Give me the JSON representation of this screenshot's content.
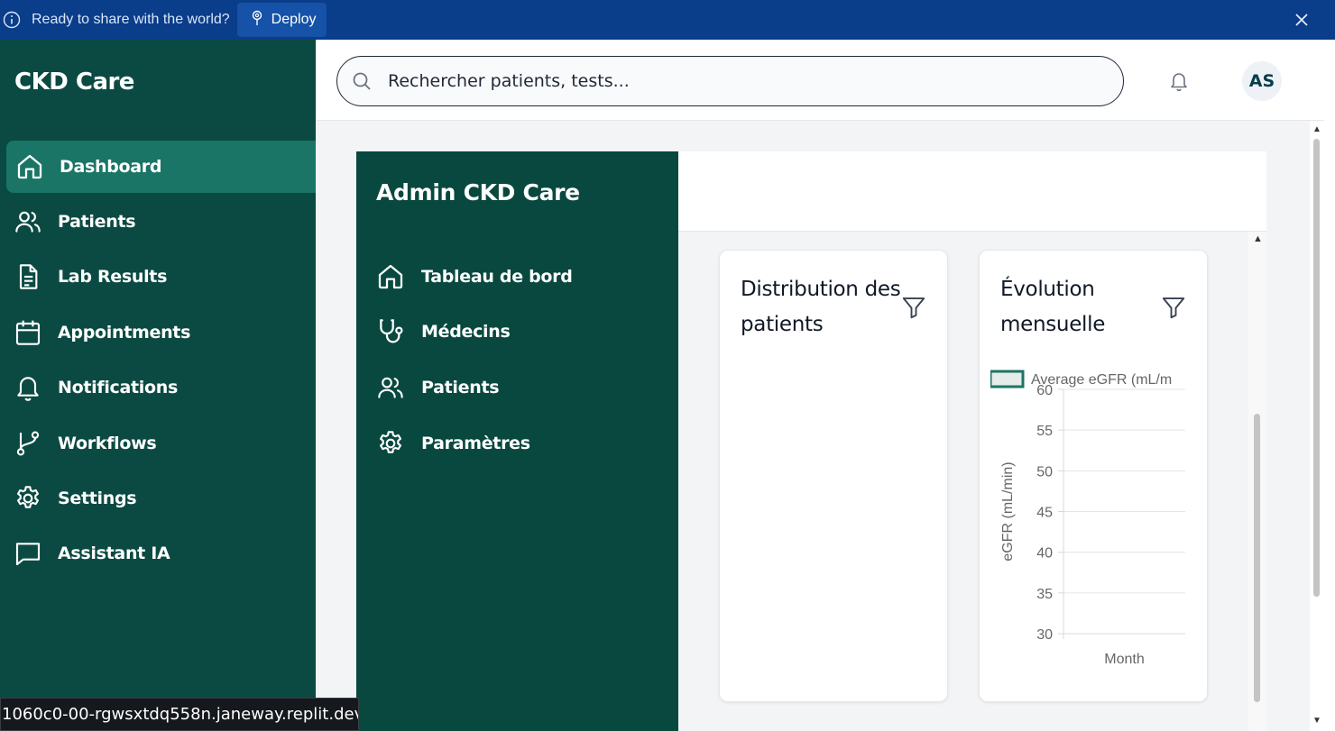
{
  "banner": {
    "message": "Ready to share with the world?",
    "deploy_label": "Deploy"
  },
  "sidebar": {
    "brand": "CKD Care",
    "items": [
      {
        "label": "Dashboard",
        "icon": "home-icon",
        "active": true
      },
      {
        "label": "Patients",
        "icon": "users-icon"
      },
      {
        "label": "Lab Results",
        "icon": "file-text-icon"
      },
      {
        "label": "Appointments",
        "icon": "calendar-icon"
      },
      {
        "label": "Notifications",
        "icon": "bell-icon"
      },
      {
        "label": "Workflows",
        "icon": "git-branch-icon"
      },
      {
        "label": "Settings",
        "icon": "gear-icon"
      },
      {
        "label": "Assistant IA",
        "icon": "message-square-icon"
      }
    ]
  },
  "header": {
    "search_placeholder": "Rechercher patients, tests...",
    "avatar_initials": "AS"
  },
  "admin": {
    "title": "Admin CKD Care",
    "items": [
      {
        "label": "Tableau de bord",
        "icon": "home-icon"
      },
      {
        "label": "Médecins",
        "icon": "stethoscope-icon"
      },
      {
        "label": "Patients",
        "icon": "users-icon"
      },
      {
        "label": "Paramètres",
        "icon": "gear-icon"
      }
    ],
    "cards": [
      {
        "title": "Distribution des patients"
      },
      {
        "title": "Évolution mensuelle"
      }
    ]
  },
  "chart_data": {
    "type": "line",
    "legend": "Average eGFR (mL/m",
    "ylabel": "eGFR (mL/min)",
    "xlabel": "Month",
    "ylim": [
      30,
      60
    ],
    "yticks": [
      60,
      55,
      50,
      45,
      40,
      35,
      30
    ],
    "series": [
      {
        "name": "Average eGFR (mL/m",
        "values": []
      }
    ],
    "grid": true,
    "legend_position": "top"
  },
  "status_url": "1060c0-00-rgwsxtdq558n.janeway.replit.dev",
  "colors": {
    "banner": "#0a3d8a",
    "sidebar": "#0b4a42",
    "sidebar_active": "#1a7566",
    "admin_sidebar": "#08483f",
    "series": "#1a7566"
  }
}
